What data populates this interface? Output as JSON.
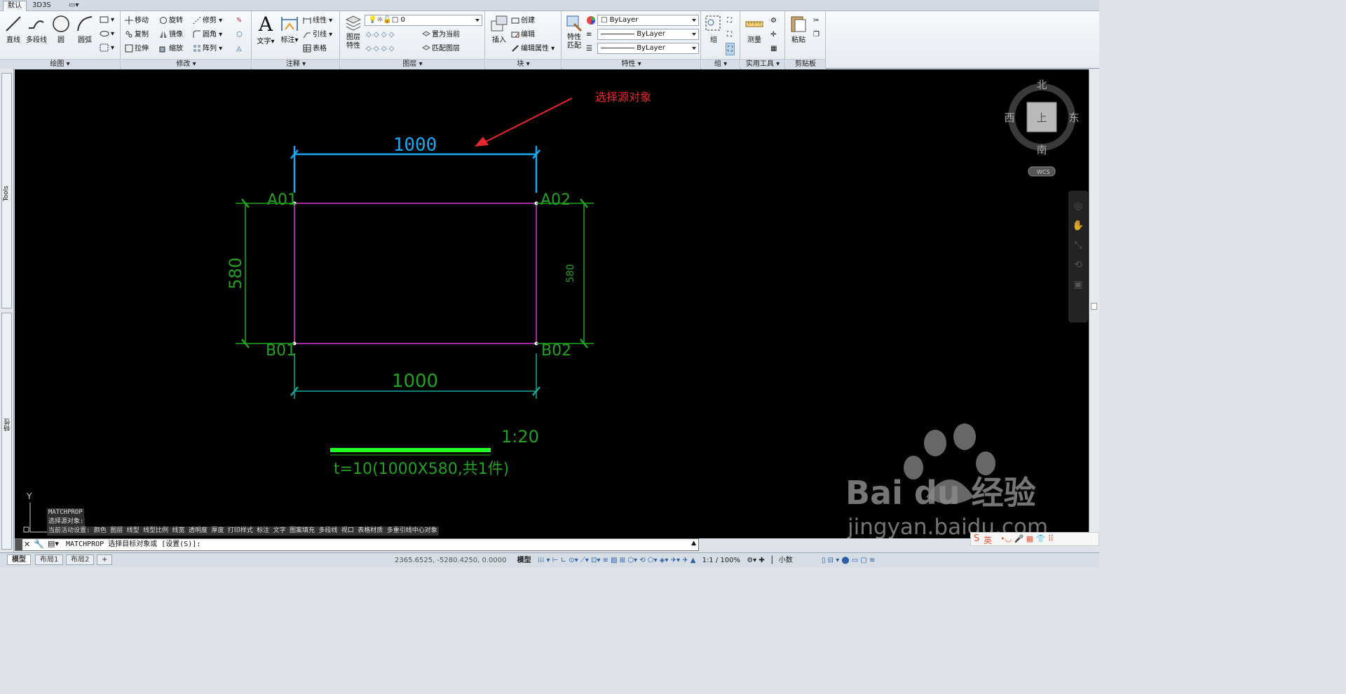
{
  "ribbon_tabs": [
    "默认",
    "3D3S",
    ""
  ],
  "draw": {
    "title": "绘图",
    "line": "直线",
    "polyline": "多段线",
    "circle": "圆",
    "arc": "圆弧"
  },
  "modify": {
    "title": "修改",
    "move": "移动",
    "rotate": "旋转",
    "trim": "修剪",
    "copy": "复制",
    "mirror": "镜像",
    "fillet": "圆角",
    "stretch": "拉伸",
    "scale": "缩放",
    "array": "阵列"
  },
  "annotate": {
    "title": "注释",
    "text": "文字",
    "dim": "标注",
    "linear": "线性",
    "leader": "引线",
    "table": "表格"
  },
  "layers": {
    "title": "图层",
    "props": "图层特性",
    "layer_value": "0",
    "setcurrent": "置为当前",
    "match": "匹配图层"
  },
  "block": {
    "title": "块",
    "insert": "插入",
    "create": "创建",
    "edit": "编辑",
    "attr": "编辑属性"
  },
  "properties": {
    "title": "特性",
    "match": "特性匹配",
    "color": "ByLayer",
    "linetype": "ByLayer",
    "lineweight": "ByLayer"
  },
  "groups": {
    "title": "组",
    "group": "组"
  },
  "utilities": {
    "title": "实用工具",
    "measure": "测量"
  },
  "clipboard": {
    "title": "剪贴板",
    "paste": "粘贴"
  },
  "palettes": {
    "tools": "Tools",
    "props": "特性"
  },
  "drawing": {
    "annotation": "选择源对象",
    "dim_top": "1000",
    "dim_bottom": "1000",
    "dim_left": "580",
    "dim_right": "580",
    "a01": "A01",
    "a02": "A02",
    "b01": "B01",
    "b02": "B02",
    "scale": "1:20",
    "caption": "t=10(1000X580,共1件)"
  },
  "viewcube": {
    "n": "北",
    "s": "南",
    "w": "西",
    "e": "东",
    "top": "上",
    "wcs": "WCS"
  },
  "ucs": {
    "y": "Y"
  },
  "command_log": [
    "MATCHPROP",
    "选择源对象:",
    "当前活动设置:  颜色 图层 线型 线型比例 线宽 透明度 厚度 打印样式 标注 文字 图案填充 多段线 视口 表格材质 多重引线中心对象"
  ],
  "command_prompt": "MATCHPROP 选择目标对象或 [设置(S)]:",
  "layout_tabs": [
    "模型",
    "布局1",
    "布局2",
    "+"
  ],
  "status": {
    "coords": "2365.6525, -5280.4250, 0.0000",
    "model": "模型",
    "scale": "1:1 / 100%",
    "units": "小数"
  },
  "watermark": {
    "brand": "Bai du 经验",
    "url": "jingyan.baidu.com"
  },
  "ime": {
    "mode": "英"
  }
}
